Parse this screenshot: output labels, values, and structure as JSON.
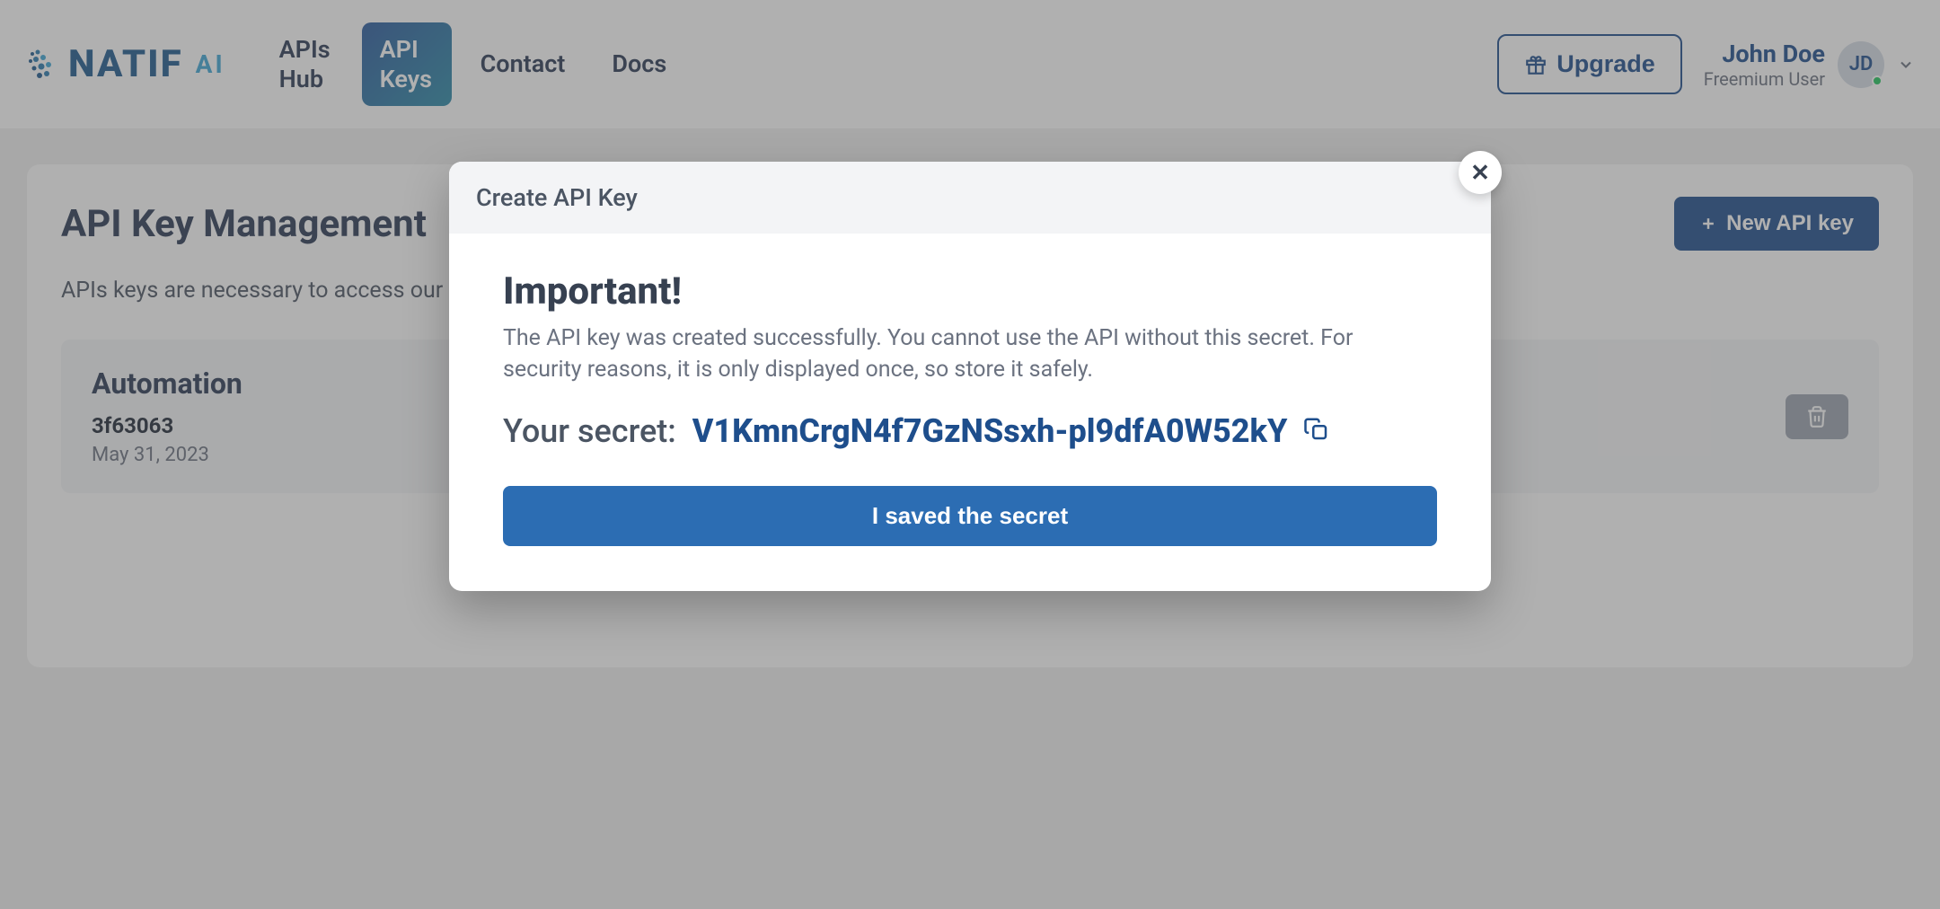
{
  "brand": {
    "name": "NATIF",
    "suffix": "AI"
  },
  "nav": {
    "apis_hub": "APIs Hub",
    "api_keys": "API Keys",
    "contact": "Contact",
    "docs": "Docs"
  },
  "header": {
    "upgrade": "Upgrade"
  },
  "user": {
    "name": "John Doe",
    "role": "Freemium User",
    "initials": "JD"
  },
  "page": {
    "title": "API Key Management",
    "new_key_button": "New API key",
    "description": "APIs keys are necessary to access our service."
  },
  "key": {
    "name": "Automation",
    "id": "3f63063",
    "date": "May 31, 2023"
  },
  "modal": {
    "title": "Create API Key",
    "heading": "Important!",
    "text": "The API key was created successfully. You cannot use the API without this secret. For security reasons, it is only displayed once, so store it safely.",
    "secret_label": "Your secret:",
    "secret_value": "V1KmnCrgN4f7GzNSsxh-pl9dfA0W52kY",
    "button": "I saved the secret",
    "close": "✕"
  }
}
